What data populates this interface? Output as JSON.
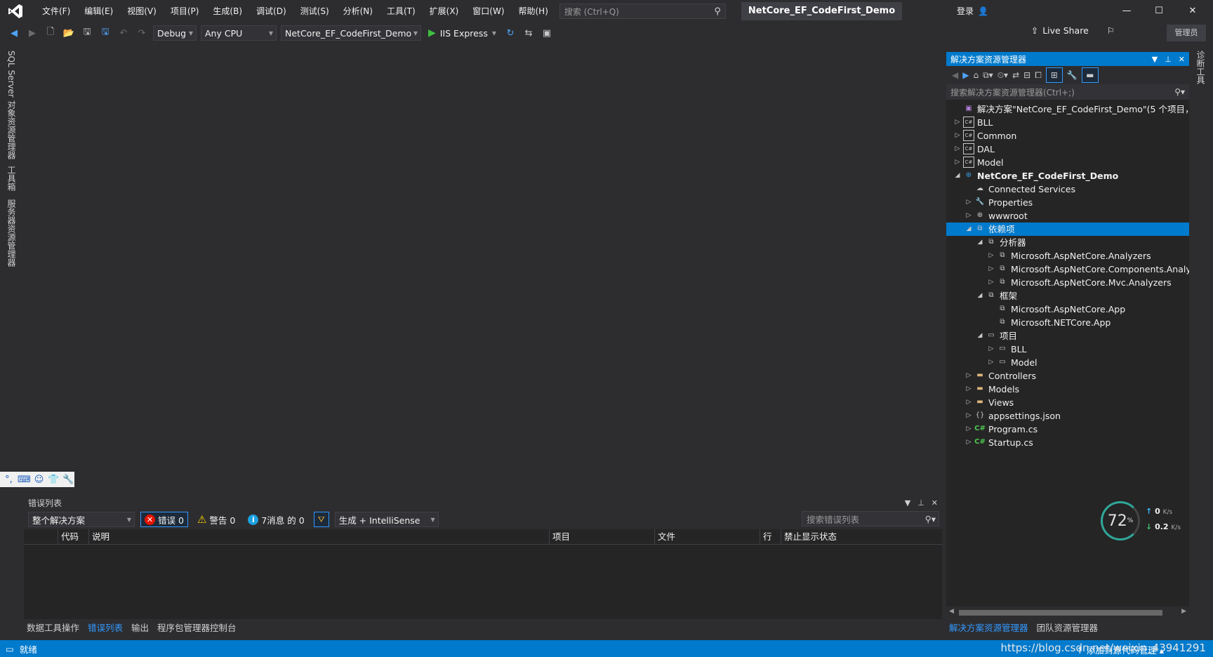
{
  "titlebar": {
    "menu": [
      "文件(F)",
      "编辑(E)",
      "视图(V)",
      "项目(P)",
      "生成(B)",
      "调试(D)",
      "测试(S)",
      "分析(N)",
      "工具(T)",
      "扩展(X)",
      "窗口(W)",
      "帮助(H)"
    ],
    "search_placeholder": "搜索 (Ctrl+Q)",
    "solution_name": "NetCore_EF_CodeFirst_Demo",
    "login": "登录",
    "minimize": "—",
    "maximize": "☐",
    "close": "✕"
  },
  "toolbar": {
    "config": "Debug",
    "platform": "Any CPU",
    "startup_project": "NetCore_EF_CodeFirst_Demo",
    "run_target": "IIS Express",
    "live_share": "Live Share",
    "admin": "管理员"
  },
  "left_rail": {
    "tabs": [
      "SQL Server 对象资源管理器",
      "工具箱",
      "服务器资源管理器"
    ]
  },
  "right_rail": {
    "tabs": [
      "诊断工具"
    ]
  },
  "error_list": {
    "title": "错误列表",
    "scope": "整个解决方案",
    "errors_label": "错误 0",
    "warnings_label": "警告 0",
    "messages_label": "7消息 的 0",
    "build_filter": "生成 + IntelliSense",
    "search_placeholder": "搜索错误列表",
    "columns": [
      "代码",
      "说明",
      "项目",
      "文件",
      "行",
      "禁止显示状态"
    ]
  },
  "bottom_tabs": [
    "数据工具操作",
    "错误列表",
    "输出",
    "程序包管理器控制台"
  ],
  "solution_explorer": {
    "title": "解决方案资源管理器",
    "search_placeholder": "搜索解决方案资源管理器(Ctrl+;)",
    "tree": [
      {
        "label": "解决方案\"NetCore_EF_CodeFirst_Demo\"(5 个项目，共 5",
        "level": 0,
        "exp": "",
        "icon": "solution-icon"
      },
      {
        "label": "BLL",
        "level": 0,
        "exp": "▷",
        "icon": "csproj-icon"
      },
      {
        "label": "Common",
        "level": 0,
        "exp": "▷",
        "icon": "csproj-icon"
      },
      {
        "label": "DAL",
        "level": 0,
        "exp": "▷",
        "icon": "csproj-icon"
      },
      {
        "label": "Model",
        "level": 0,
        "exp": "▷",
        "icon": "csproj-icon"
      },
      {
        "label": "NetCore_EF_CodeFirst_Demo",
        "level": 0,
        "exp": "◢",
        "icon": "webproj-icon",
        "bold": true
      },
      {
        "label": "Connected Services",
        "level": 1,
        "exp": "",
        "icon": "connected-services-icon"
      },
      {
        "label": "Properties",
        "level": 1,
        "exp": "▷",
        "icon": "properties-icon"
      },
      {
        "label": "wwwroot",
        "level": 1,
        "exp": "▷",
        "icon": "globe-icon"
      },
      {
        "label": "依赖项",
        "level": 1,
        "exp": "◢",
        "icon": "dependencies-icon",
        "selected": true
      },
      {
        "label": "分析器",
        "level": 2,
        "exp": "◢",
        "icon": "analyzer-icon"
      },
      {
        "label": "Microsoft.AspNetCore.Analyzers",
        "level": 3,
        "exp": "▷",
        "icon": "analyzer-icon"
      },
      {
        "label": "Microsoft.AspNetCore.Components.Analy",
        "level": 3,
        "exp": "▷",
        "icon": "analyzer-icon"
      },
      {
        "label": "Microsoft.AspNetCore.Mvc.Analyzers",
        "level": 3,
        "exp": "▷",
        "icon": "analyzer-icon"
      },
      {
        "label": "框架",
        "level": 2,
        "exp": "◢",
        "icon": "framework-icon"
      },
      {
        "label": "Microsoft.AspNetCore.App",
        "level": 3,
        "exp": "",
        "icon": "framework-icon"
      },
      {
        "label": "Microsoft.NETCore.App",
        "level": 3,
        "exp": "",
        "icon": "framework-icon"
      },
      {
        "label": "项目",
        "level": 2,
        "exp": "◢",
        "icon": "project-ref-icon"
      },
      {
        "label": "BLL",
        "level": 3,
        "exp": "▷",
        "icon": "project-ref-icon"
      },
      {
        "label": "Model",
        "level": 3,
        "exp": "▷",
        "icon": "project-ref-icon"
      },
      {
        "label": "Controllers",
        "level": 1,
        "exp": "▷",
        "icon": "folder-icon"
      },
      {
        "label": "Models",
        "level": 1,
        "exp": "▷",
        "icon": "folder-icon"
      },
      {
        "label": "Views",
        "level": 1,
        "exp": "▷",
        "icon": "folder-icon"
      },
      {
        "label": "appsettings.json",
        "level": 1,
        "exp": "▷",
        "icon": "json-file-icon"
      },
      {
        "label": "Program.cs",
        "level": 1,
        "exp": "▷",
        "icon": "csharp-file-icon"
      },
      {
        "label": "Startup.cs",
        "level": 1,
        "exp": "▷",
        "icon": "csharp-file-icon"
      }
    ],
    "tabs": [
      "解决方案资源管理器",
      "团队资源管理器"
    ]
  },
  "net_widget": {
    "percent": "72",
    "percent_unit": "%",
    "upload": "0",
    "download": "0.2",
    "unit": "K/s"
  },
  "statusbar": {
    "status": "就绪",
    "add_source": "↑ 添加到源代码管理 ▴",
    "watermark": "https://blog.csdn.net/weixin_43941291"
  }
}
